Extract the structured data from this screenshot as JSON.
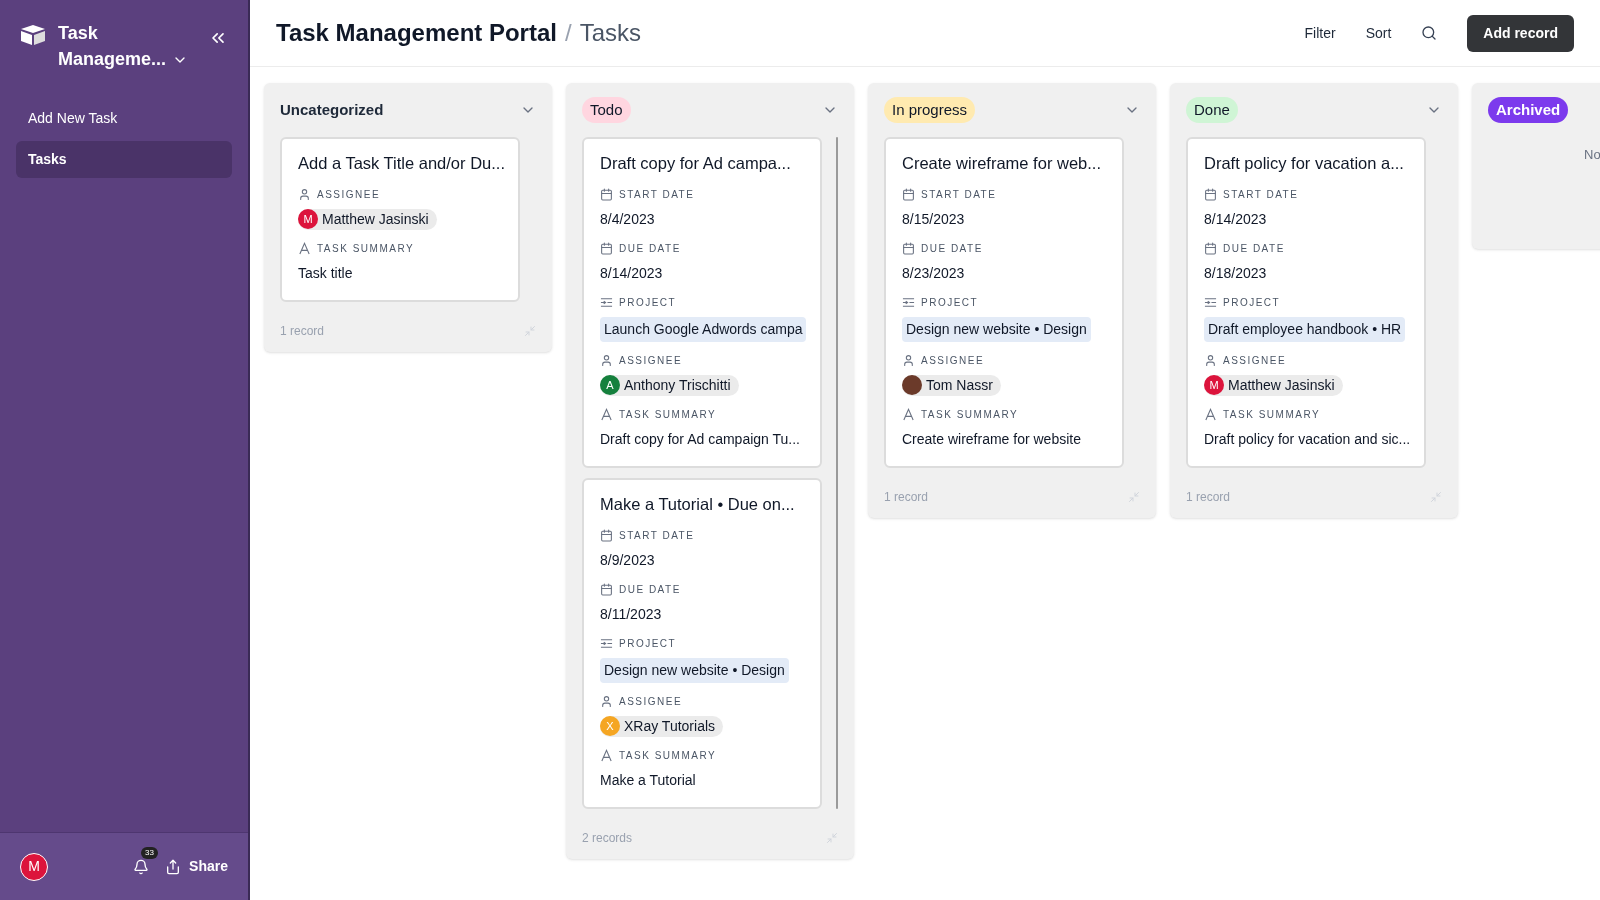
{
  "sidebar": {
    "app_name": "Task Manageme...",
    "items": [
      {
        "label": "Add New Task",
        "selected": false
      },
      {
        "label": "Tasks",
        "selected": true
      }
    ],
    "user_initial": "M",
    "notification_count": "33",
    "share_label": "Share"
  },
  "header": {
    "title": "Task Management Portal",
    "separator": "/",
    "view": "Tasks",
    "actions": [
      "Filter",
      "Sort"
    ],
    "add_button": "Add record"
  },
  "columns": [
    {
      "label": "Uncategorized",
      "kind": "plain",
      "footer": "1 record",
      "cards": [
        {
          "title": "Add a Task Title and/or Du...",
          "fields": [
            {
              "kind": "assignee",
              "label": "ASSIGNEE",
              "value": "Matthew Jasinski",
              "photo": false,
              "initial": "M",
              "color": "#dc143c"
            },
            {
              "kind": "summary",
              "label": "TASK SUMMARY",
              "value": "Task title"
            }
          ]
        }
      ]
    },
    {
      "label": "Todo",
      "kind": "pill",
      "color": "#ffd6e0",
      "footer": "2 records",
      "cards": [
        {
          "title": "Draft copy for Ad campa...",
          "fields": [
            {
              "kind": "date",
              "label": "START DATE",
              "value": "8/4/2023"
            },
            {
              "kind": "date",
              "label": "DUE DATE",
              "value": "8/14/2023"
            },
            {
              "kind": "project",
              "label": "PROJECT",
              "value": "Launch Google Adwords campa"
            },
            {
              "kind": "assignee",
              "label": "ASSIGNEE",
              "value": "Anthony Trischitti",
              "photo": false,
              "initial": "A",
              "color": "#15803d"
            },
            {
              "kind": "summary",
              "label": "TASK SUMMARY",
              "value": "Draft copy for Ad campaign Tu..."
            }
          ]
        },
        {
          "title": "Make a Tutorial • Due on...",
          "fields": [
            {
              "kind": "date",
              "label": "START DATE",
              "value": "8/9/2023"
            },
            {
              "kind": "date",
              "label": "DUE DATE",
              "value": "8/11/2023"
            },
            {
              "kind": "project",
              "label": "PROJECT",
              "value": "Design new website • Design"
            },
            {
              "kind": "assignee",
              "label": "ASSIGNEE",
              "value": "XRay Tutorials",
              "photo": false,
              "initial": "X",
              "color": "#f5a623"
            },
            {
              "kind": "summary",
              "label": "TASK SUMMARY",
              "value": "Make a Tutorial"
            }
          ]
        }
      ]
    },
    {
      "label": "In progress",
      "kind": "pill",
      "color": "#ffeab0",
      "footer": "1 record",
      "cards": [
        {
          "title": "Create wireframe for web...",
          "fields": [
            {
              "kind": "date",
              "label": "START DATE",
              "value": "8/15/2023"
            },
            {
              "kind": "date",
              "label": "DUE DATE",
              "value": "8/23/2023"
            },
            {
              "kind": "project",
              "label": "PROJECT",
              "value": "Design new website • Design"
            },
            {
              "kind": "assignee",
              "label": "ASSIGNEE",
              "value": "Tom Nassr",
              "photo": true
            },
            {
              "kind": "summary",
              "label": "TASK SUMMARY",
              "value": "Create wireframe for website"
            }
          ]
        }
      ]
    },
    {
      "label": "Done",
      "kind": "pill",
      "color": "#cff5d5",
      "footer": "1 record",
      "cards": [
        {
          "title": "Draft policy for vacation a...",
          "fields": [
            {
              "kind": "date",
              "label": "START DATE",
              "value": "8/14/2023"
            },
            {
              "kind": "date",
              "label": "DUE DATE",
              "value": "8/18/2023"
            },
            {
              "kind": "project",
              "label": "PROJECT",
              "value": "Draft employee handbook • HR"
            },
            {
              "kind": "assignee",
              "label": "ASSIGNEE",
              "value": "Matthew Jasinski",
              "photo": false,
              "initial": "M",
              "color": "#dc143c"
            },
            {
              "kind": "summary",
              "label": "TASK SUMMARY",
              "value": "Draft policy for vacation and sic..."
            }
          ]
        }
      ]
    },
    {
      "label": "Archived",
      "kind": "solid",
      "color": "#7c3aed",
      "empty_text": "No"
    }
  ]
}
